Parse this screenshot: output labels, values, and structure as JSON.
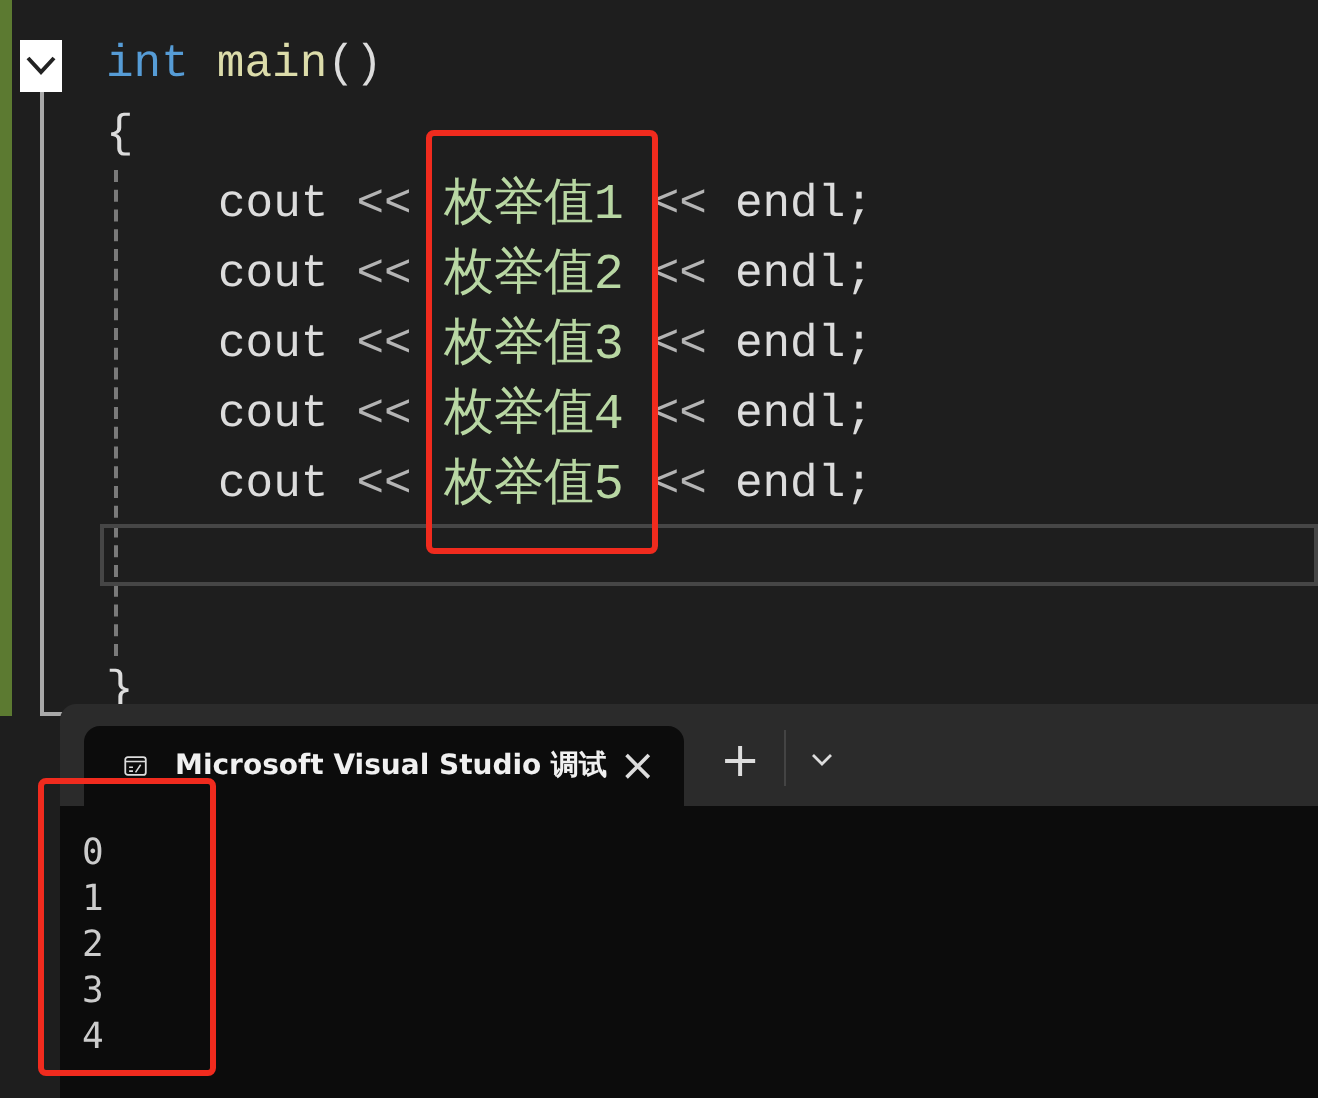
{
  "editor": {
    "signature": [
      {
        "kind": "keyword",
        "text": "int"
      },
      {
        "kind": "function",
        "text": "main"
      },
      {
        "kind": "punct",
        "text": "()"
      }
    ],
    "open_brace": "{",
    "body": [
      {
        "kind": "statement",
        "stream": "cout",
        "op": "<<",
        "value": "枚举值1",
        "op2": "<<",
        "end": "endl;"
      },
      {
        "kind": "statement",
        "stream": "cout",
        "op": "<<",
        "value": "枚举值2",
        "op2": "<<",
        "end": "endl;"
      },
      {
        "kind": "statement",
        "stream": "cout",
        "op": "<<",
        "value": "枚举值3",
        "op2": "<<",
        "end": "endl;"
      },
      {
        "kind": "statement",
        "stream": "cout",
        "op": "<<",
        "value": "枚举值4",
        "op2": "<<",
        "end": "endl;"
      },
      {
        "kind": "statement",
        "stream": "cout",
        "op": "<<",
        "value": "枚举值5",
        "op2": "<<",
        "end": "endl;"
      },
      {
        "kind": "blank",
        "current": true
      },
      {
        "kind": "blank"
      }
    ],
    "close_brace": "}",
    "expanded": true
  },
  "terminal": {
    "tab": {
      "title": "Microsoft Visual Studio 调试",
      "close": "×"
    },
    "new_tab": "+",
    "output": [
      "0",
      "1",
      "2",
      "3",
      "4"
    ]
  }
}
